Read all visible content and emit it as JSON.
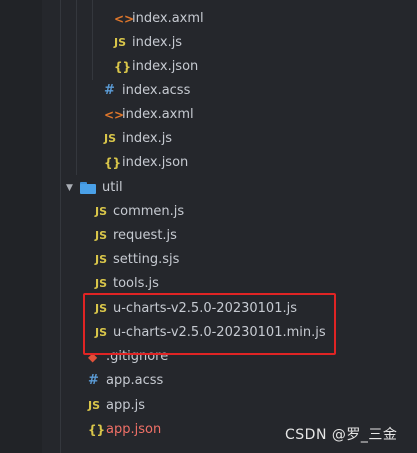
{
  "explorer": {
    "files": [
      {
        "name": "index.axml",
        "type": "xml",
        "icon_glyph": "<>"
      },
      {
        "name": "index.js",
        "type": "js",
        "icon_glyph": "JS"
      },
      {
        "name": "index.json",
        "type": "json",
        "icon_glyph": "{}"
      },
      {
        "name": "index.acss",
        "type": "css",
        "icon_glyph": "#"
      },
      {
        "name": "index.axml",
        "type": "xml",
        "icon_glyph": "<>"
      },
      {
        "name": "index.js",
        "type": "js",
        "icon_glyph": "JS"
      },
      {
        "name": "index.json",
        "type": "json",
        "icon_glyph": "{}"
      },
      {
        "name": "util",
        "type": "folder",
        "expanded": true
      },
      {
        "name": "commen.js",
        "type": "js",
        "icon_glyph": "JS"
      },
      {
        "name": "request.js",
        "type": "js",
        "icon_glyph": "JS"
      },
      {
        "name": "setting.sjs",
        "type": "js",
        "icon_glyph": "JS"
      },
      {
        "name": "tools.js",
        "type": "js",
        "icon_glyph": "JS"
      },
      {
        "name": "u-charts-v2.5.0-20230101.js",
        "type": "js",
        "icon_glyph": "JS"
      },
      {
        "name": "u-charts-v2.5.0-20230101.min.js",
        "type": "js",
        "icon_glyph": "JS"
      },
      {
        "name": ".gitignore",
        "type": "git",
        "icon_glyph": "◆"
      },
      {
        "name": "app.acss",
        "type": "css",
        "icon_glyph": "#"
      },
      {
        "name": "app.js",
        "type": "js",
        "icon_glyph": "JS"
      },
      {
        "name": "app.json",
        "type": "json",
        "icon_glyph": "{}",
        "modified": true
      }
    ]
  },
  "watermark": "CSDN @罗_三金",
  "colors": {
    "background": "#25272c",
    "js_icon": "#d9c64a",
    "xml_icon": "#e0772b",
    "css_icon": "#5b9bd5",
    "folder": "#4aa0e8",
    "highlight_box": "#e02424",
    "modified_text": "#f07067"
  }
}
